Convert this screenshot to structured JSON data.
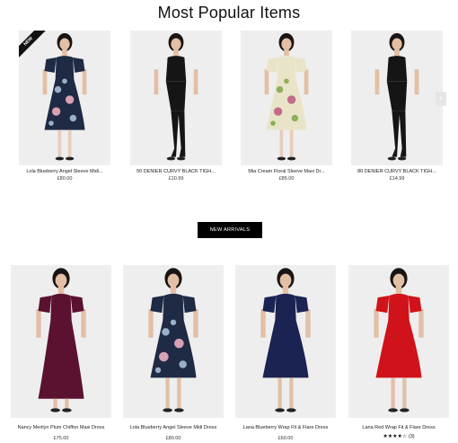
{
  "section_title": "Most Popular Items",
  "new_badge": "NEW",
  "next_icon": "chevron-right-icon",
  "popular": [
    {
      "name": "Lola Blueberry Angel Sleeve Midi...",
      "price": "£80.00",
      "dress": "#1f2a44",
      "pattern": "floral-navy",
      "legs": "#e8cdb9"
    },
    {
      "name": "50 DENIER CURVY BLACK TIGH...",
      "price": "£10.99",
      "dress": "#151515",
      "pattern": "tights",
      "legs": "#151515"
    },
    {
      "name": "Mia Cream Floral Sleeve Maxi Dr...",
      "price": "£85.00",
      "dress": "#e9e4c8",
      "pattern": "floral-cream",
      "legs": "#e8cdb9"
    },
    {
      "name": "80 DENIER CURVY BLACK TIGH...",
      "price": "£14.99",
      "dress": "#151515",
      "pattern": "tights",
      "legs": "#151515"
    }
  ],
  "cta_label": "NEW ARRIVALS",
  "arrivals": [
    {
      "name": "Nancy Merilyn Plum Chiffon Maxi Dress",
      "price": "£75.00",
      "dress": "#5b1130",
      "pattern": "maxi"
    },
    {
      "name": "Lola Blueberry Angel Sleeve Midi Dress",
      "price": "£80.00",
      "dress": "#1f2a44",
      "pattern": "floral-navy"
    },
    {
      "name": "Lana Blueberry Wrap Fit & Flare Dress",
      "price": "£60.00",
      "dress": "#1b2352",
      "pattern": "wrap"
    },
    {
      "name": "Lana Red Wrap Fit & Flare Dress",
      "rating_stars": "★★★★☆",
      "rating_count": "(3)",
      "dress": "#d0121b",
      "pattern": "wrap"
    }
  ]
}
